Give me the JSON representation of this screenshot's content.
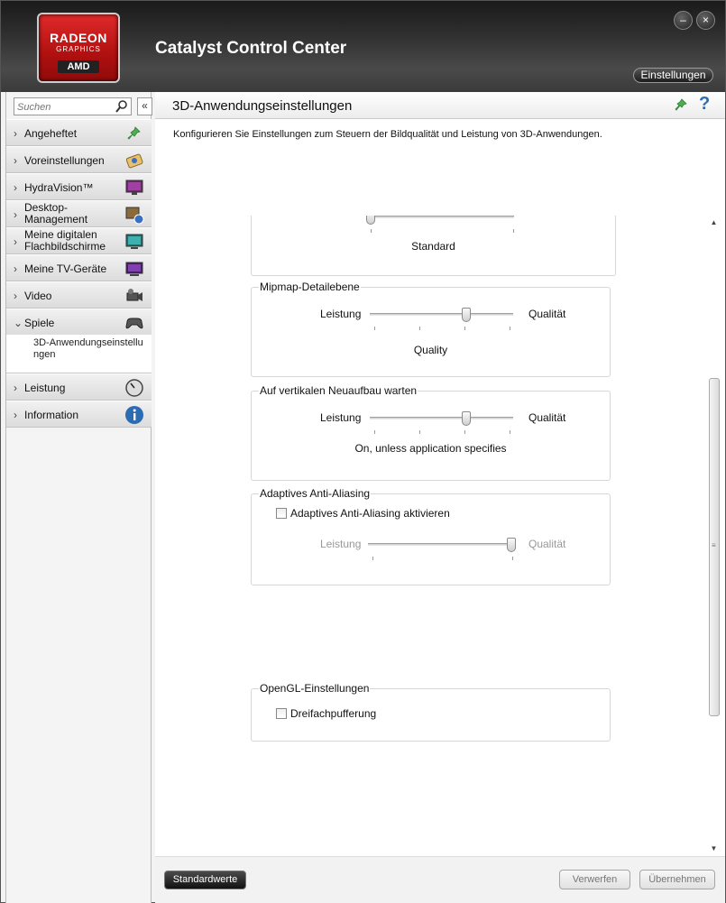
{
  "header": {
    "logo": {
      "line1": "RADEON",
      "line2": "GRAPHICS",
      "line3": "AMD"
    },
    "title": "Catalyst Control Center",
    "minimize_glyph": "–",
    "close_glyph": "×",
    "settings_label": "Einstellungen"
  },
  "sidebar": {
    "search_placeholder": "Suchen",
    "collapse_glyph": "«",
    "chevron_glyph": "›",
    "expanded_glyph": "⌄",
    "items": [
      {
        "label": "Angeheftet",
        "icon": "pin-icon"
      },
      {
        "label": "Voreinstellungen",
        "icon": "presets-icon"
      },
      {
        "label": "HydraVision™",
        "icon": "monitor-icon"
      },
      {
        "label": "Desktop-\nManagement",
        "icon": "desktop-management-icon"
      },
      {
        "label": "Meine digitalen\nFlachbildschirme",
        "icon": "flat-panel-icon"
      },
      {
        "label": "Meine TV-Geräte",
        "icon": "tv-icon"
      },
      {
        "label": "Video",
        "icon": "video-camera-icon"
      },
      {
        "label": "Spiele",
        "icon": "gamepad-icon",
        "expanded": true
      },
      {
        "label": "Leistung",
        "icon": "gauge-icon"
      },
      {
        "label": "Information",
        "icon": "info-icon"
      }
    ],
    "sub_item": "3D-Anwendungseinstellungen"
  },
  "main": {
    "title": "3D-Anwendungseinstellungen",
    "help_glyph": "?",
    "description": "Konfigurieren Sie Einstellungen zum Steuern der Bildqualität und Leistung von 3D-Anwendungen.",
    "scroll_up_glyph": "▲",
    "scroll_down_glyph": "▼",
    "scroll_grip_glyph": "≡",
    "groups": {
      "partial": {
        "value": "Standard",
        "slider_position": 0
      },
      "mipmap": {
        "title": "Mipmap-Detailebene",
        "left_label": "Leistung",
        "right_label": "Qualität",
        "value": "Quality",
        "slider_position": 0.67
      },
      "vsync": {
        "title": "Auf vertikalen Neuaufbau warten",
        "left_label": "Leistung",
        "right_label": "Qualität",
        "value": "On, unless application specifies",
        "slider_position": 0.67
      },
      "adaptive_aa": {
        "title": "Adaptives Anti-Aliasing",
        "checkbox_label": "Adaptives Anti-Aliasing aktivieren",
        "checked": false,
        "left_label": "Leistung",
        "right_label": "Qualität",
        "slider_position": 1.0
      },
      "opengl": {
        "title": "OpenGL-Einstellungen",
        "checkbox_label": "Dreifachpufferung",
        "checked": false
      }
    }
  },
  "footer": {
    "defaults_label": "Standardwerte",
    "discard_label": "Verwerfen",
    "apply_label": "Übernehmen"
  }
}
